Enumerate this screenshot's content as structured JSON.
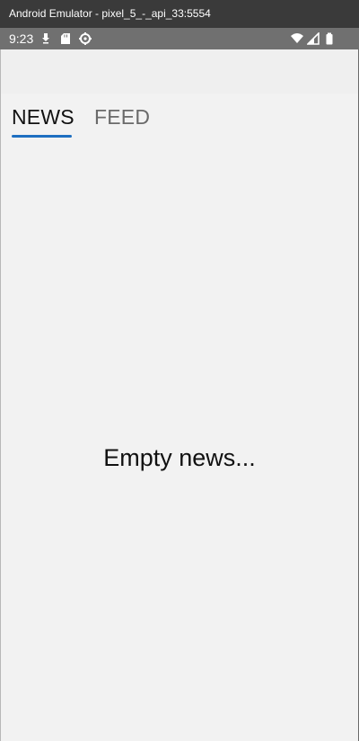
{
  "window": {
    "title": "Android Emulator - pixel_5_-_api_33:5554"
  },
  "status_bar": {
    "time": "9:23",
    "left_icons": [
      "download-icon",
      "sd-card-icon",
      "settings-gear-icon"
    ],
    "right_icons": [
      "wifi-icon",
      "signal-icon",
      "battery-icon"
    ]
  },
  "tabs": [
    {
      "label": "NEWS",
      "selected": true
    },
    {
      "label": "FEED",
      "selected": false
    }
  ],
  "content": {
    "empty_message": "Empty news..."
  },
  "colors": {
    "accent": "#1e6fc1",
    "title_bar": "#3a3a3a",
    "status_bar": "#707070",
    "background": "#f2f2f2"
  }
}
